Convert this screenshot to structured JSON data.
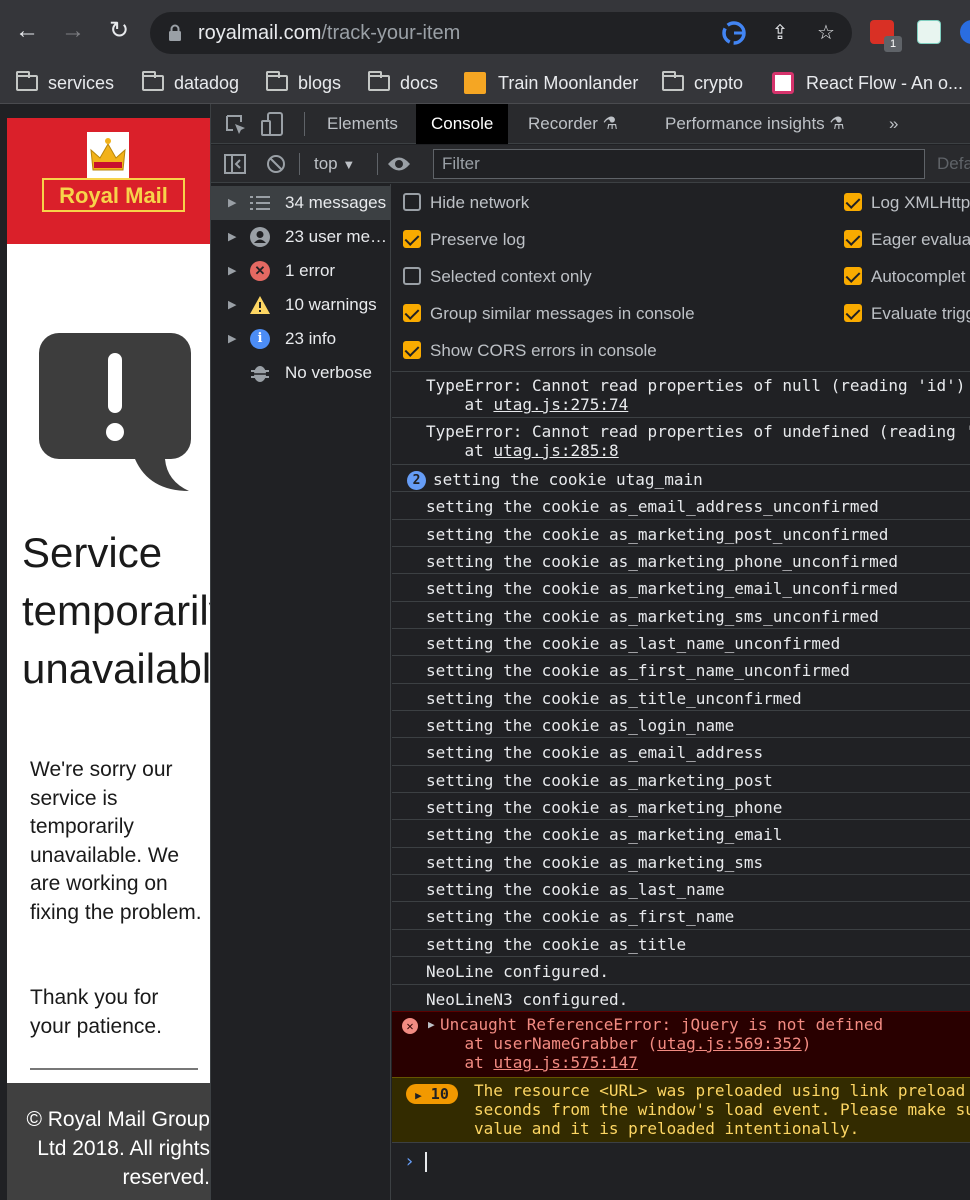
{
  "browser": {
    "url_host": "royalmail.com",
    "url_path": "/track-your-item",
    "extension_badge": "1",
    "bookmarks": [
      {
        "label": "services",
        "icon": "folder-icon"
      },
      {
        "label": "datadog",
        "icon": "folder-icon"
      },
      {
        "label": "blogs",
        "icon": "folder-icon"
      },
      {
        "label": "docs",
        "icon": "folder-icon"
      },
      {
        "label": "Train Moonlander",
        "icon": "moonlander-favicon"
      },
      {
        "label": "crypto",
        "icon": "folder-icon"
      },
      {
        "label": "React Flow - An o...",
        "icon": "react-flow-favicon"
      }
    ]
  },
  "page": {
    "logo_text": "Royal Mail",
    "title_lines": [
      "Service",
      "temporarily",
      "unavailable"
    ],
    "body_p1": "We're sorry our service is temporarily unavailable. We are working on fixing the problem.",
    "body_p2": "Thank you for your patience.",
    "footer": "© Royal Mail Group\nLtd 2018. All rights\nreserved."
  },
  "devtools": {
    "tabs": [
      "Elements",
      "Console",
      "Recorder",
      "Performance insights",
      "»"
    ],
    "active_tab": "Console",
    "context": "top",
    "filter_placeholder": "Filter",
    "default_levels": "Defa",
    "sidebar": [
      {
        "label": "34 messages",
        "icon": "list-icon",
        "selected": true
      },
      {
        "label": "23 user me…",
        "icon": "user-icon"
      },
      {
        "label": "1 error",
        "icon": "error-icon"
      },
      {
        "label": "10 warnings",
        "icon": "warning-icon"
      },
      {
        "label": "23 info",
        "icon": "info-icon"
      },
      {
        "label": "No verbose",
        "icon": "bug-icon"
      }
    ],
    "settings_left": [
      {
        "label": "Hide network",
        "checked": false
      },
      {
        "label": "Preserve log",
        "checked": true
      },
      {
        "label": "Selected context only",
        "checked": false
      },
      {
        "label": "Group similar messages in console",
        "checked": true
      },
      {
        "label": "Show CORS errors in console",
        "checked": true
      }
    ],
    "settings_right": [
      {
        "label": "Log XMLHttp",
        "checked": true
      },
      {
        "label": "Eager evalua",
        "checked": true
      },
      {
        "label": "Autocomplet",
        "checked": true
      },
      {
        "label": "Evaluate trigg",
        "checked": true
      }
    ],
    "messages": {
      "m1_line1": "TypeError: Cannot read properties of null (reading 'id')",
      "m1_line2_prefix": "    at ",
      "m1_link": "utag.js:275:74",
      "m2_line1": "TypeError: Cannot read properties of undefined (reading 'i",
      "m2_line2_prefix": "    at ",
      "m2_link": "utag.js:285:8",
      "m3_count": "2",
      "m3_text": "setting the cookie utag_main",
      "cookies": [
        "setting the cookie as_email_address_unconfirmed",
        "setting the cookie as_marketing_post_unconfirmed",
        "setting the cookie as_marketing_phone_unconfirmed",
        "setting the cookie as_marketing_email_unconfirmed",
        "setting the cookie as_marketing_sms_unconfirmed",
        "setting the cookie as_last_name_unconfirmed",
        "setting the cookie as_first_name_unconfirmed",
        "setting the cookie as_title_unconfirmed",
        "setting the cookie as_login_name",
        "setting the cookie as_email_address",
        "setting the cookie as_marketing_post",
        "setting the cookie as_marketing_phone",
        "setting the cookie as_marketing_email",
        "setting the cookie as_marketing_sms",
        "setting the cookie as_last_name",
        "setting the cookie as_first_name",
        "setting the cookie as_title",
        "NeoLine configured.",
        "NeoLineN3 configured."
      ],
      "err_line1": "Uncaught ReferenceError: jQuery is not defined",
      "err_line2_prefix": "    at userNameGrabber (",
      "err_line2_link": "utag.js:569:352",
      "err_line2_suffix": ")",
      "err_line3_prefix": "    at ",
      "err_line3_link": "utag.js:575:147",
      "warn_count": "10",
      "warn_line1": "The resource <URL> was preloaded using link preload b",
      "warn_line2": "seconds from the window's load event. Please make sur",
      "warn_line3": "value and it is preloaded intentionally."
    },
    "prompt": "›"
  }
}
